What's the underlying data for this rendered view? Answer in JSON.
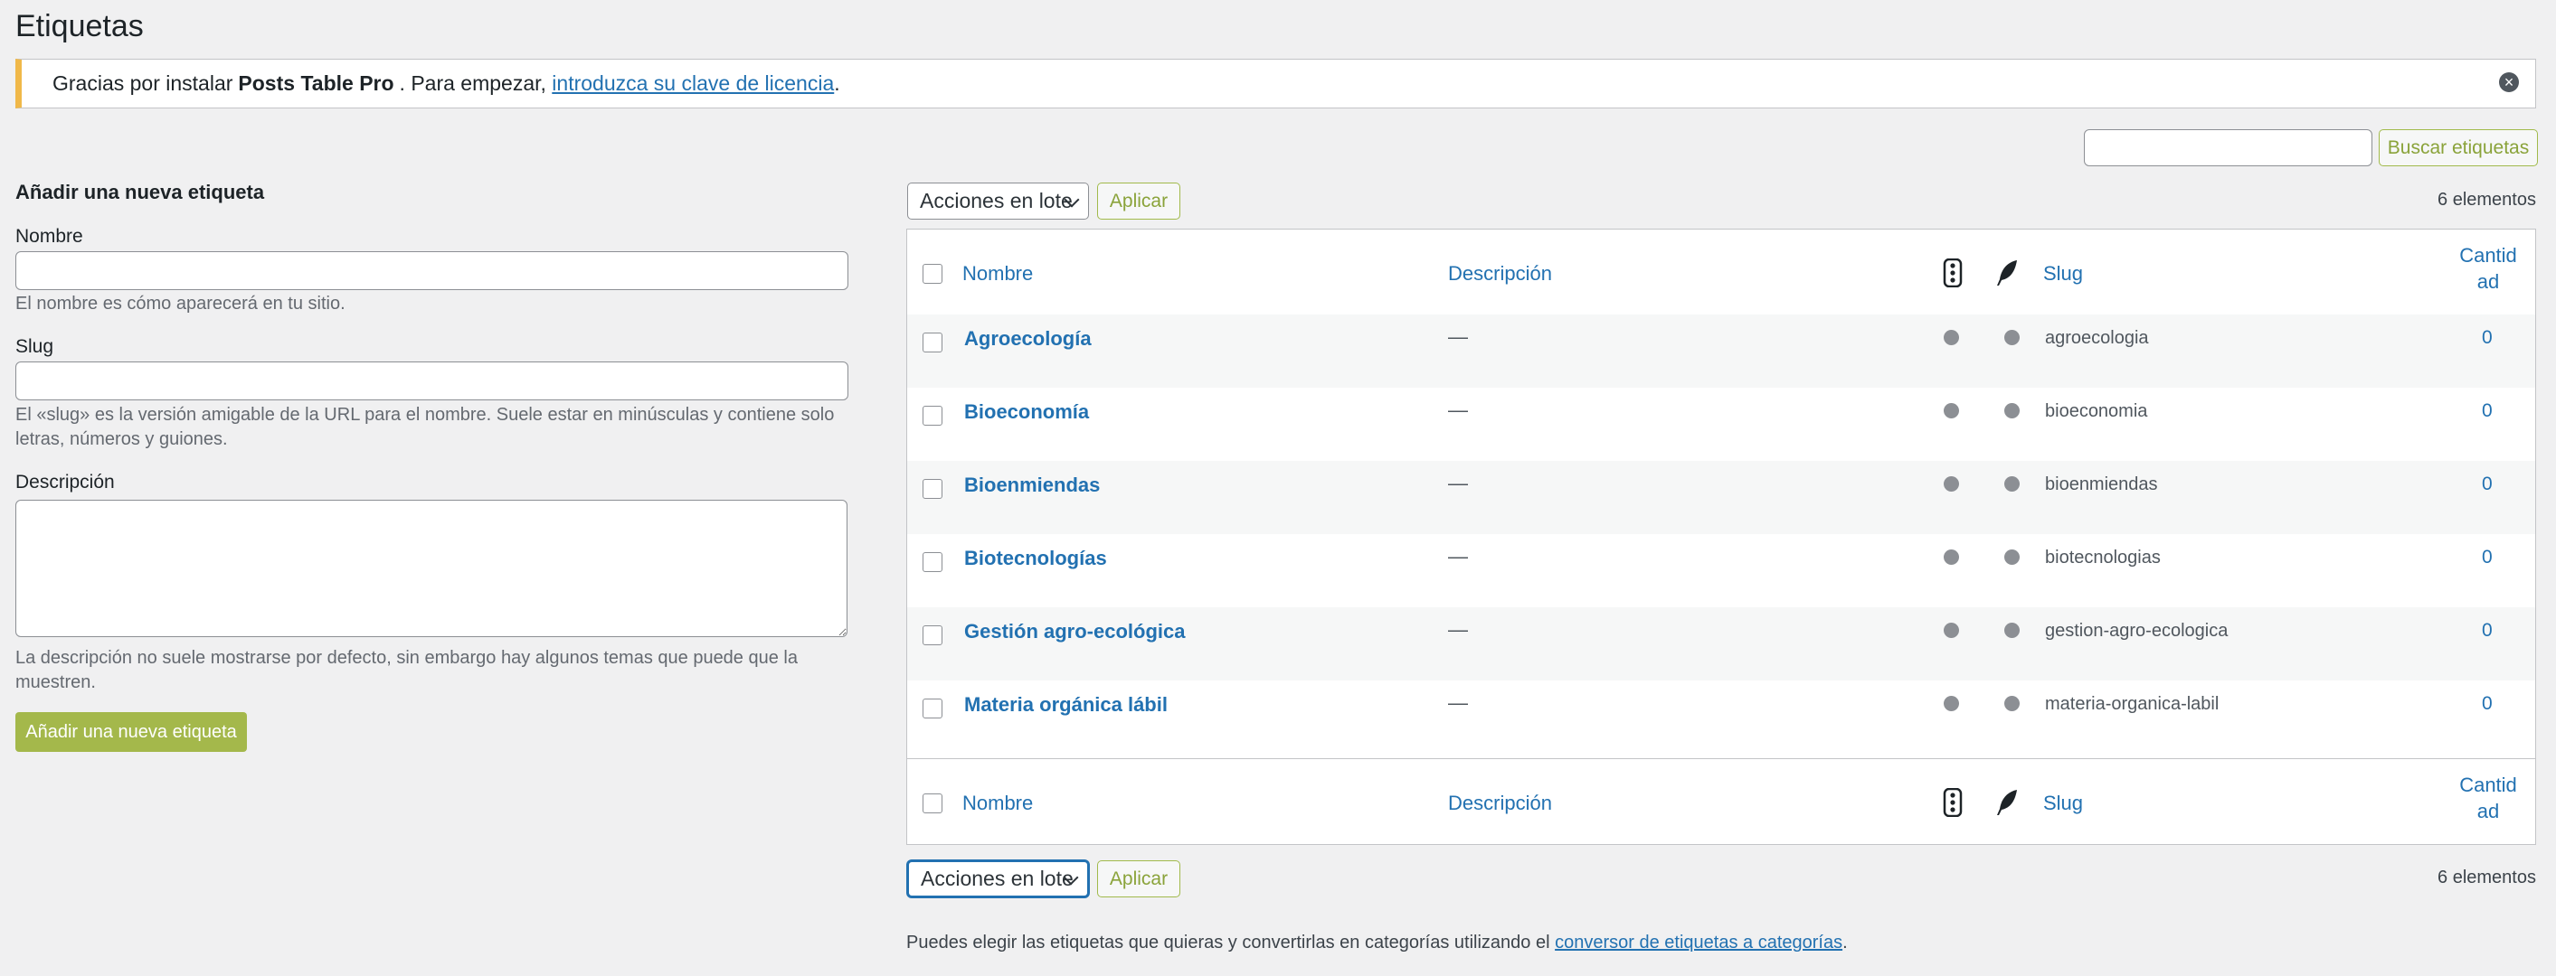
{
  "page": {
    "title": "Etiquetas"
  },
  "notice": {
    "text_before": "Gracias por instalar",
    "product": "Posts Table Pro",
    "text_middle": ". Para empezar,",
    "link": "introduzca su clave de licencia",
    "text_after": "."
  },
  "search": {
    "button": "Buscar etiquetas",
    "value": ""
  },
  "form": {
    "title": "Añadir una nueva etiqueta",
    "name_label": "Nombre",
    "name_help": "El nombre es cómo aparecerá en tu sitio.",
    "slug_label": "Slug",
    "slug_help": "El «slug» es la versión amigable de la URL para el nombre. Suele estar en minúsculas y contiene solo letras, números y guiones.",
    "desc_label": "Descripción",
    "desc_help": "La descripción no suele mostrarse por defecto, sin embargo hay algunos temas que puede que la muestren.",
    "submit": "Añadir una nueva etiqueta"
  },
  "bulk": {
    "select": "Acciones en lote",
    "apply": "Aplicar",
    "count": "6 elementos"
  },
  "table": {
    "columns": {
      "name": "Nombre",
      "description": "Descripción",
      "slug": "Slug",
      "count": "Cantidad"
    },
    "rows": [
      {
        "name": "Agroecología",
        "description": "—",
        "slug": "agroecologia",
        "count": "0"
      },
      {
        "name": "Bioeconomía",
        "description": "—",
        "slug": "bioeconomia",
        "count": "0"
      },
      {
        "name": "Bioenmiendas",
        "description": "—",
        "slug": "bioenmiendas",
        "count": "0"
      },
      {
        "name": "Biotecnologías",
        "description": "—",
        "slug": "biotecnologias",
        "count": "0"
      },
      {
        "name": "Gestión agro-ecológica",
        "description": "—",
        "slug": "gestion-agro-ecologica",
        "count": "0"
      },
      {
        "name": "Materia orgánica lábil",
        "description": "—",
        "slug": "materia-organica-labil",
        "count": "0"
      }
    ]
  },
  "footer": {
    "text": "Puedes elegir las etiquetas que quieras y convertirlas en categorías utilizando el",
    "link": "conversor de etiquetas a categorías",
    "after": "."
  },
  "icons": {
    "notice_dismiss": "close-circle-icon",
    "column_icon_1": "traffic-light-icon",
    "column_icon_2": "feather-icon",
    "row_status": "dot-icon"
  }
}
